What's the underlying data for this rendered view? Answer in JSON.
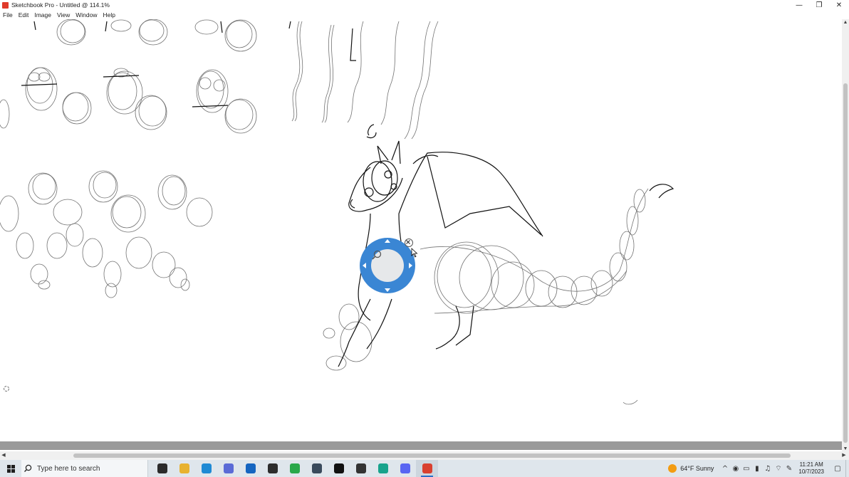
{
  "window": {
    "title": "Sketchbook Pro - Untitled @ 114.1%",
    "controls": {
      "minimize": "—",
      "restore": "❐",
      "close": "✕"
    }
  },
  "menu": [
    "File",
    "Edit",
    "Image",
    "View",
    "Window",
    "Help"
  ],
  "canvas": {
    "tools": {
      "zoom_puck": {
        "icon": "magnifier-icon",
        "close_icon": "close-icon",
        "color": "#3a86d4"
      }
    }
  },
  "taskbar": {
    "search_placeholder": "Type here to search",
    "apps": [
      {
        "name": "task-view-icon",
        "color": "#2b2b2b"
      },
      {
        "name": "file-explorer-icon",
        "color": "#e8b230"
      },
      {
        "name": "edge-icon",
        "color": "#1f8ad4"
      },
      {
        "name": "browser-icon",
        "color": "#5b6bd6"
      },
      {
        "name": "mail-icon",
        "color": "#1565c0"
      },
      {
        "name": "vs-icon",
        "color": "#2d2d2d"
      },
      {
        "name": "store-icon",
        "color": "#2aa84a"
      },
      {
        "name": "photos-icon",
        "color": "#3a4a5c"
      },
      {
        "name": "tiktok-icon",
        "color": "#111111"
      },
      {
        "name": "xbox-icon",
        "color": "#333333"
      },
      {
        "name": "teal-app-icon",
        "color": "#18a38c"
      },
      {
        "name": "discord-icon",
        "color": "#5865f2"
      },
      {
        "name": "sketchbook-icon",
        "color": "#d9402f"
      }
    ],
    "active_app": "sketchbook-icon",
    "weather": {
      "temp": "64°F",
      "condition": "Sunny"
    },
    "tray_icons": [
      "^",
      "◉",
      "▭",
      "▮",
      "♫",
      "⌔",
      "✎"
    ],
    "time": "11:21 AM",
    "date": "10/7/2023",
    "notifications": "▢"
  }
}
